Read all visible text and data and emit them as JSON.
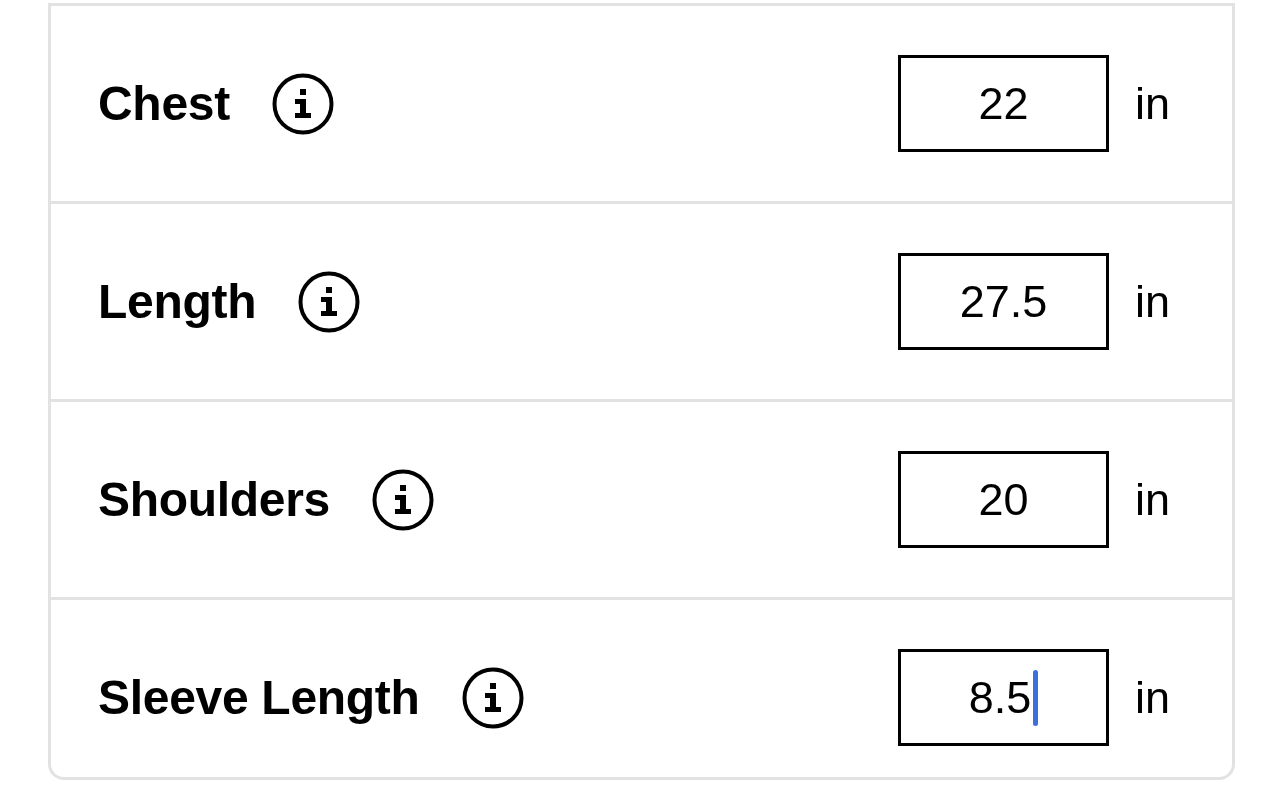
{
  "rows": [
    {
      "label": "Chest",
      "value": "22",
      "unit": "in",
      "focused": false
    },
    {
      "label": "Length",
      "value": "27.5",
      "unit": "in",
      "focused": false
    },
    {
      "label": "Shoulders",
      "value": "20",
      "unit": "in",
      "focused": false
    },
    {
      "label": "Sleeve Length",
      "value": "8.5",
      "unit": "in",
      "focused": true
    }
  ]
}
